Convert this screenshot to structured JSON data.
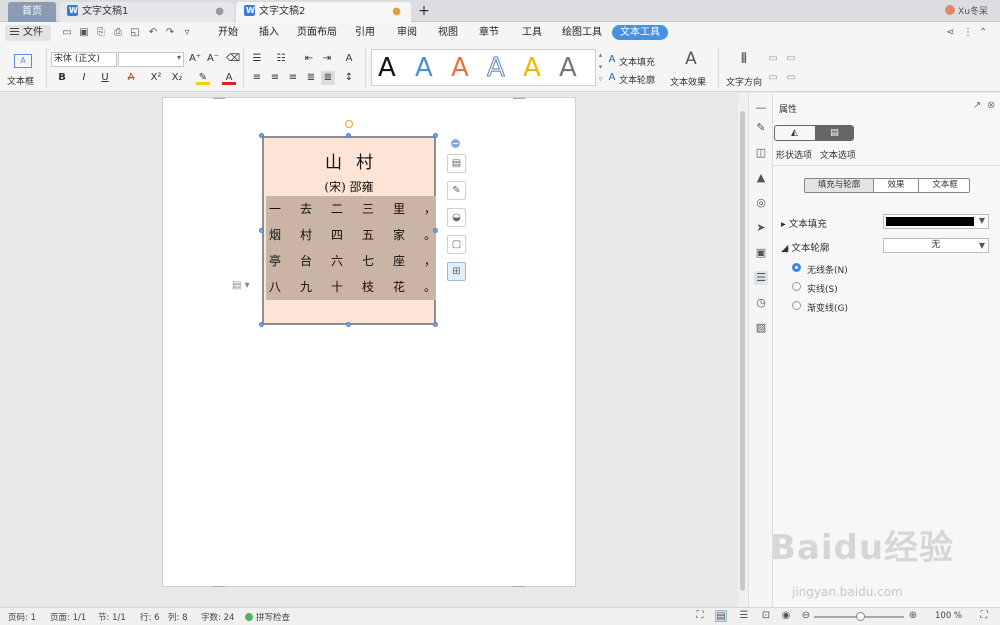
{
  "tabs": {
    "home": "首页",
    "doc1": "文字文稿1",
    "doc2": "文字文稿2",
    "doc1_close": "●",
    "doc2_modified": "●",
    "new_tab": "+"
  },
  "user": {
    "name": "Xu冬呆"
  },
  "menu": {
    "file": "文件",
    "items": [
      "开始",
      "插入",
      "页面布局",
      "引用",
      "审阅",
      "视图",
      "章节",
      "工具",
      "绘图工具",
      "文本工具"
    ]
  },
  "ribbon": {
    "textbox_label": "文本框",
    "font_name": "宋体 (正文)",
    "text_fill": "文本填充",
    "text_outline": "文本轮廓",
    "text_effect": "文本效果",
    "text_direction": "文字方向",
    "style_glyph": "A",
    "style_colors": [
      "#111111",
      "#4a90d9",
      "#e8743b",
      "#5a7fb8",
      "#f2b705",
      "#777777"
    ]
  },
  "poem": {
    "title": "山村",
    "author": "(宋) 邵雍",
    "lines": [
      [
        "一",
        "去",
        "二",
        "三",
        "里",
        "，"
      ],
      [
        "烟",
        "村",
        "四",
        "五",
        "家",
        "。"
      ],
      [
        "亭",
        "台",
        "六",
        "七",
        "座",
        "，"
      ],
      [
        "八",
        "九",
        "十",
        "枝",
        "花",
        "。"
      ]
    ],
    "bg_color": "#fde4d6",
    "highlight_color": "#c9b4a6"
  },
  "props": {
    "title": "属性",
    "tab_shape": "形状选项",
    "tab_text": "文本选项",
    "sub_tabs": [
      "填充与轮廓",
      "效果",
      "文本框"
    ],
    "text_fill_label": "文本填充",
    "text_fill_color": "#000000",
    "text_outline_label": "文本轮廓",
    "text_outline_value": "无",
    "radios": [
      "无线条(N)",
      "实线(S)",
      "渐变线(G)"
    ],
    "selected_radio": 0
  },
  "status": {
    "page_no": "页码: 1",
    "pages": "页面: 1/1",
    "section": "节: 1/1",
    "row": "行: 6",
    "col": "列: 8",
    "words": "字数: 24",
    "spell": "拼写检查",
    "zoom": "100 %"
  },
  "watermark": {
    "brand": "Baidu经验",
    "url": "jingyan.baidu.com"
  },
  "icons": [
    "close-icon",
    "undo-icon",
    "redo-icon",
    "print-icon",
    "save-icon",
    "share-icon",
    "more-icon",
    "zoom-in-icon",
    "zoom-out-icon",
    "fullscreen-icon"
  ]
}
